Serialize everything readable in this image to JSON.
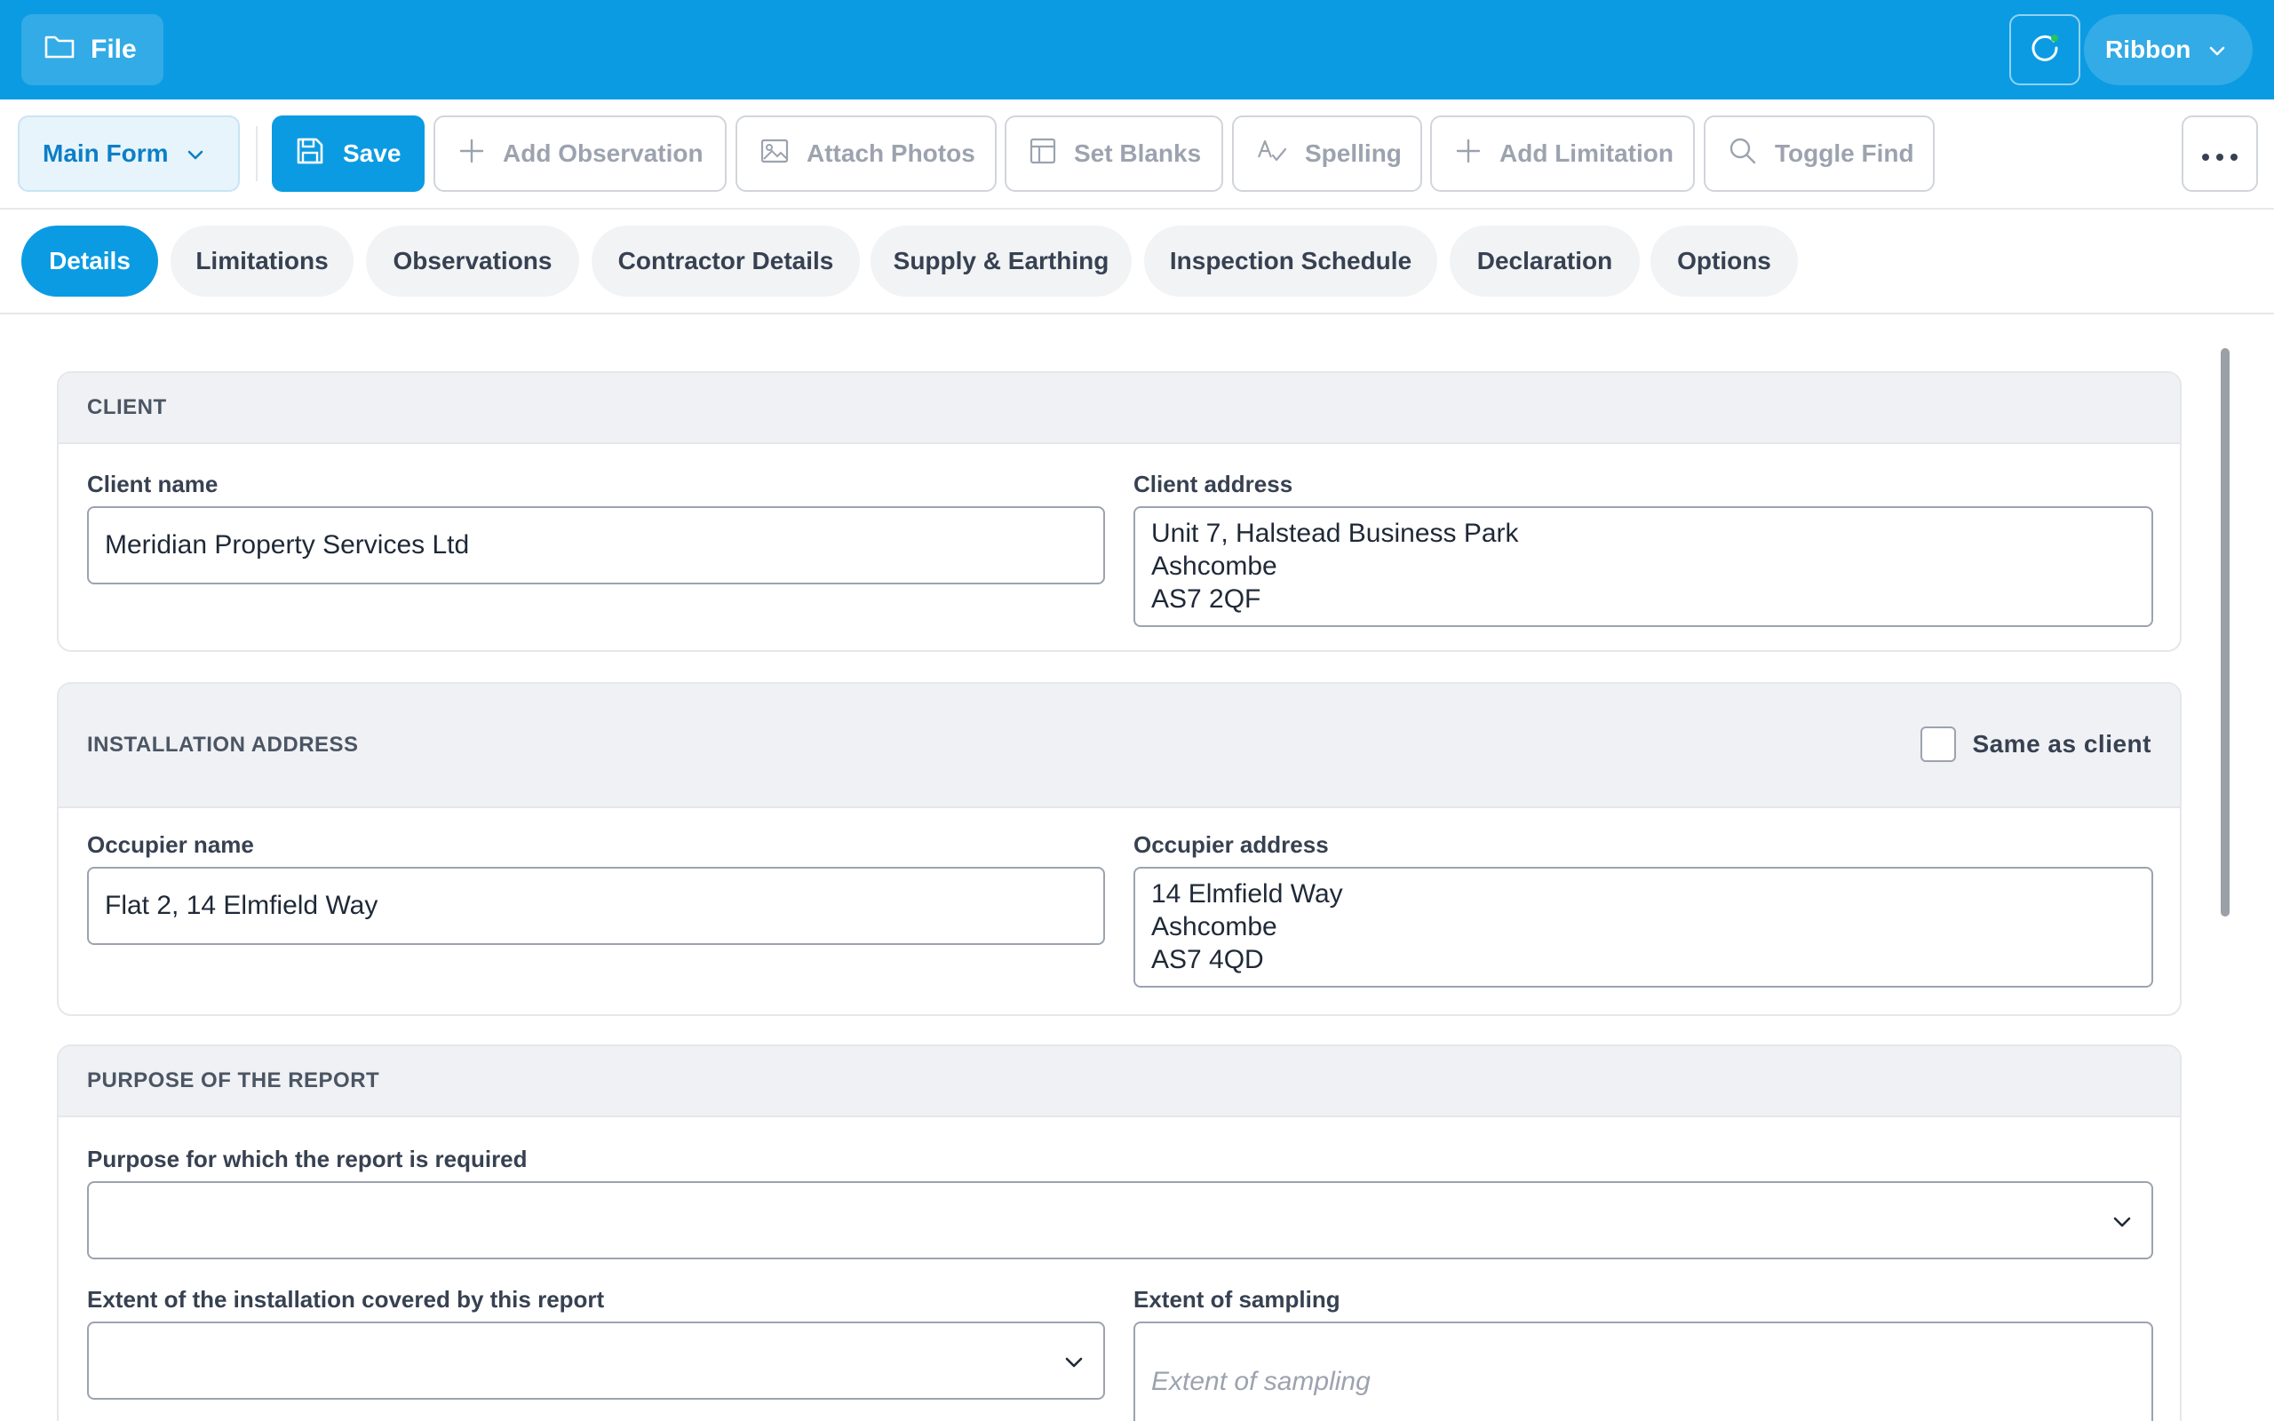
{
  "topbar": {
    "file_label": "File",
    "ribbon_label": "Ribbon",
    "colors": {
      "brand": "#0b9be2",
      "status_dot": "#22c55e"
    }
  },
  "toolbar": {
    "main_form_label": "Main Form",
    "save_label": "Save",
    "add_observation_label": "Add Observation",
    "attach_photos_label": "Attach Photos",
    "set_blanks_label": "Set Blanks",
    "spelling_label": "Spelling",
    "add_limitation_label": "Add Limitation",
    "toggle_find_label": "Toggle Find"
  },
  "tabs": [
    {
      "label": "Details",
      "active": true
    },
    {
      "label": "Limitations",
      "active": false
    },
    {
      "label": "Observations",
      "active": false
    },
    {
      "label": "Contractor Details",
      "active": false
    },
    {
      "label": "Supply & Earthing",
      "active": false
    },
    {
      "label": "Inspection Schedule",
      "active": false
    },
    {
      "label": "Declaration",
      "active": false
    },
    {
      "label": "Options",
      "active": false
    }
  ],
  "client": {
    "heading": "CLIENT",
    "name_label": "Client name",
    "name_value": "Meridian Property Services Ltd",
    "address_label": "Client address",
    "address_value": "Unit 7, Halstead Business Park\nAshcombe\nAS7 2QF"
  },
  "installation": {
    "heading": "INSTALLATION ADDRESS",
    "same_as_client_label": "Same as client",
    "same_as_client_checked": false,
    "occupier_name_label": "Occupier name",
    "occupier_name_value": "Flat 2, 14 Elmfield Way",
    "occupier_address_label": "Occupier address",
    "occupier_address_value": "14 Elmfield Way\nAshcombe\nAS7 4QD"
  },
  "purpose": {
    "heading": "PURPOSE OF THE REPORT",
    "purpose_label": "Purpose for which the report is required",
    "purpose_value": "",
    "extent_label": "Extent of the installation covered by this report",
    "extent_value": "",
    "sampling_label": "Extent of sampling",
    "sampling_placeholder": "Extent of sampling"
  }
}
